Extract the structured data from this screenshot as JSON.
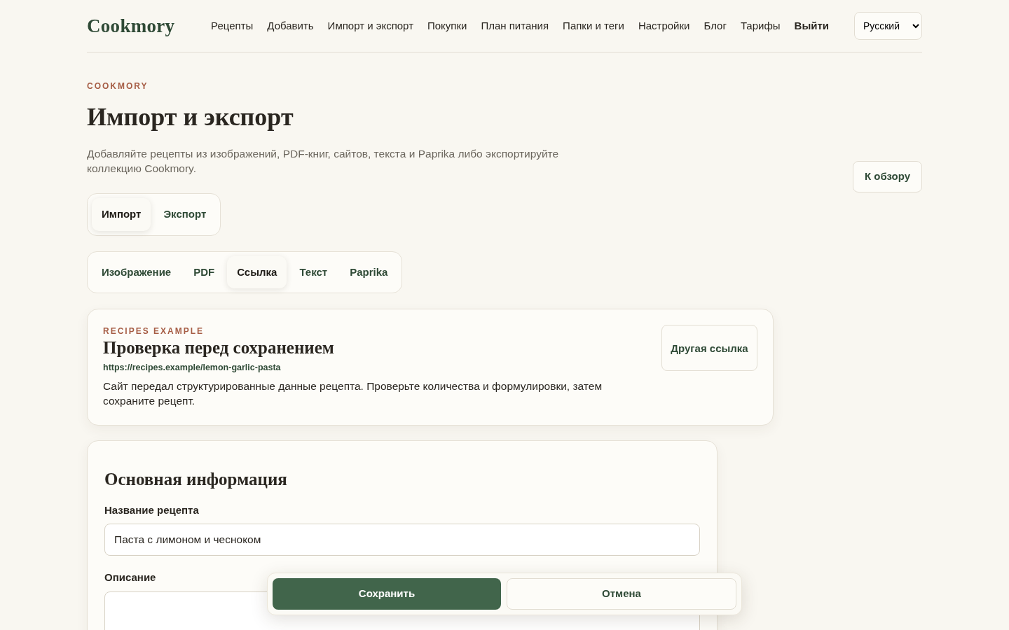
{
  "brand": "Cookmory",
  "nav": [
    {
      "label": "Рецепты",
      "kind": "link"
    },
    {
      "label": "Добавить",
      "kind": "link"
    },
    {
      "label": "Импорт и экспорт",
      "kind": "link"
    },
    {
      "label": "Покупки",
      "kind": "link"
    },
    {
      "label": "План питания",
      "kind": "link"
    },
    {
      "label": "Папки и теги",
      "kind": "link"
    },
    {
      "label": "Настройки",
      "kind": "link"
    },
    {
      "label": "Блог",
      "kind": "link"
    },
    {
      "label": "Тарифы",
      "kind": "link"
    },
    {
      "label": "Выйти",
      "kind": "action"
    }
  ],
  "language": "Русский",
  "eyebrow": "COOKMORY",
  "title": "Импорт и экспорт",
  "intro": "Добавляйте рецепты из изображений, PDF-книг, сайтов, текста и Paprika либо экспортируйте коллекцию Cookmory.",
  "back_button": "К обзору",
  "mode_tabs": [
    {
      "label": "Импорт",
      "selected": true
    },
    {
      "label": "Экспорт",
      "selected": false
    }
  ],
  "source_tabs": [
    {
      "label": "Изображение",
      "selected": false
    },
    {
      "label": "PDF",
      "selected": false
    },
    {
      "label": "Ссылка",
      "selected": true
    },
    {
      "label": "Текст",
      "selected": false
    },
    {
      "label": "Paprika",
      "selected": false
    }
  ],
  "preview": {
    "eyebrow": "RECIPES EXAMPLE",
    "title": "Проверка перед сохранением",
    "url": "https://recipes.example/lemon-garlic-pasta",
    "message": "Сайт передал структурированные данные рецепта. Проверьте количества и формулировки, затем сохраните рецепт.",
    "button": "Другая ссылка"
  },
  "form": {
    "title": "Основная информация",
    "fields": [
      {
        "label": "Название рецепта",
        "kind": "input",
        "value": "Паста с лимоном и чесноком"
      },
      {
        "label": "Описание",
        "kind": "textarea"
      }
    ]
  },
  "actions": [
    {
      "label": "Сохранить",
      "kind": "primary"
    },
    {
      "label": "Отмена",
      "kind": "secondary"
    }
  ]
}
